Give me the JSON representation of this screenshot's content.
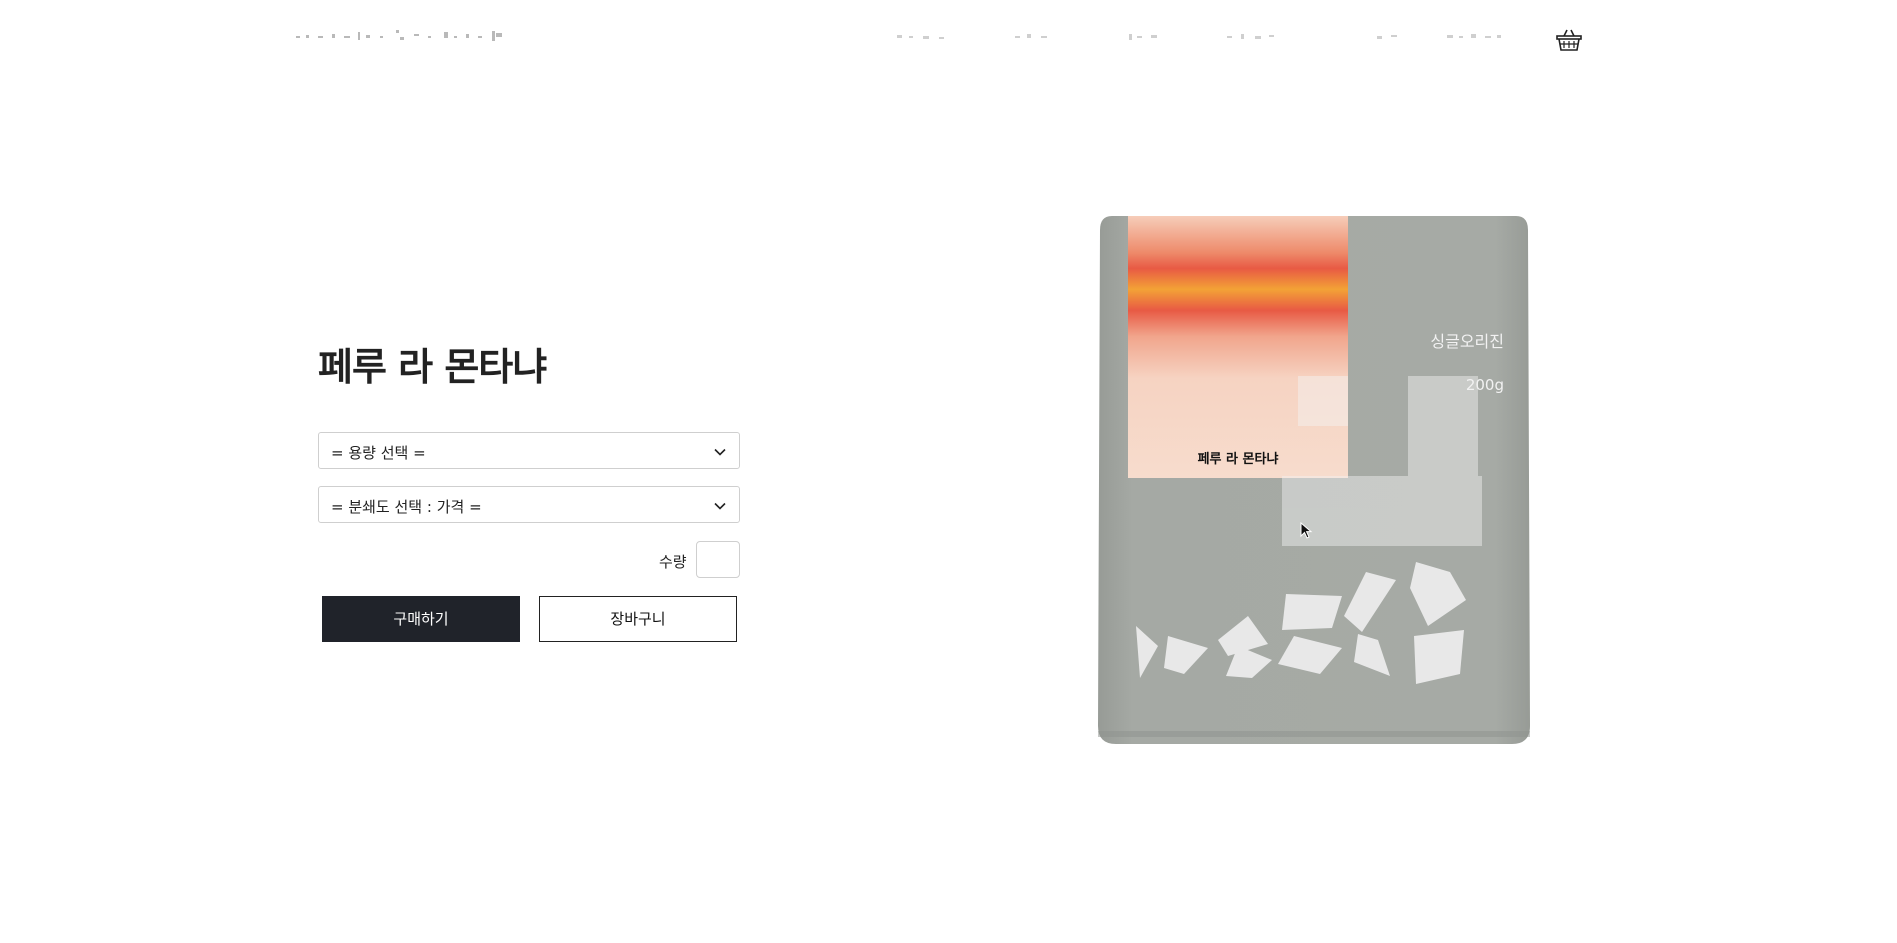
{
  "header": {
    "cart_icon": "basket-icon"
  },
  "product": {
    "title": "페루 라 몬타냐",
    "bag_label_name": "페루 라 몬타냐",
    "bag_brand": "싱글오리진",
    "bag_weight": "200g",
    "bag_color": "#a4a8a3",
    "label_gradient": [
      "#f5c9b5",
      "#e8553f",
      "#f0a63a"
    ]
  },
  "options": {
    "capacity_select": "= 용량 선택 =",
    "grind_select": "= 분쇄도 선택 : 가격 ="
  },
  "quantity": {
    "label": "수량",
    "value": ""
  },
  "buttons": {
    "buy": "구매하기",
    "cart": "장바구니"
  }
}
